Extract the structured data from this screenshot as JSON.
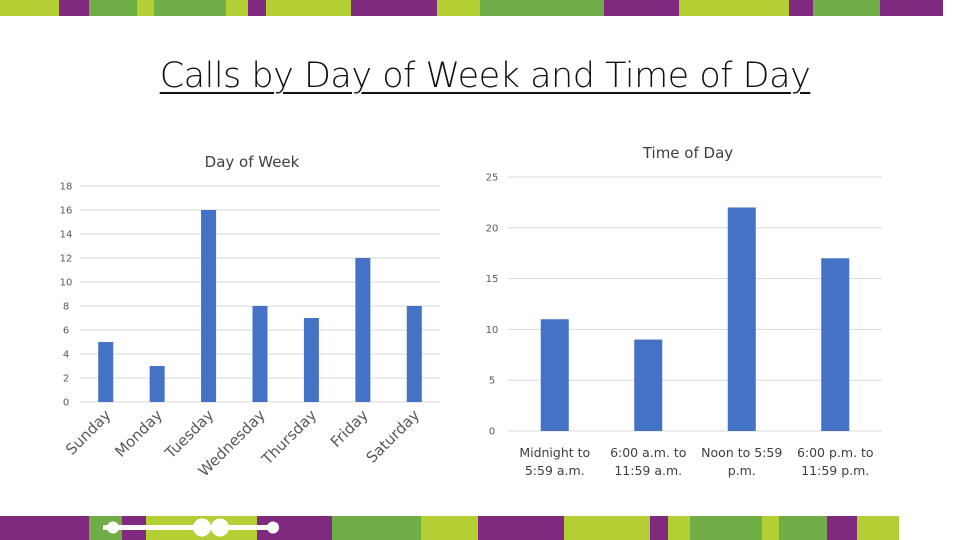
{
  "page": {
    "title": "Calls by Day of Week and Time of Day"
  },
  "decor": {
    "colors": {
      "lime": "#b3cf33",
      "green": "#70ad47",
      "purple": "#7f2a7f",
      "bar": "#4472c4",
      "grid": "#d9d9d9"
    },
    "top_band": [
      "lime",
      "purple",
      "green",
      "lime",
      "green",
      "lime",
      "purple",
      "lime",
      "purple",
      "lime",
      "green",
      "purple",
      "lime",
      "purple",
      "green",
      "purple"
    ],
    "bottom_band": [
      "purple",
      "green",
      "purple",
      "lime",
      "purple",
      "green",
      "green",
      "lime",
      "purple",
      "lime",
      "purple",
      "lime",
      "green",
      "lime",
      "green",
      "purple",
      "lime"
    ],
    "logo_icon": "utensils-dots-icon"
  },
  "chart_data": [
    {
      "type": "bar",
      "title": "Day of Week",
      "categories": [
        "Sunday",
        "Monday",
        "Tuesday",
        "Wednesday",
        "Thursday",
        "Friday",
        "Saturday"
      ],
      "values": [
        5,
        3,
        16,
        8,
        7,
        12,
        8
      ],
      "ylim": [
        0,
        18
      ],
      "yticks": [
        "0",
        "2",
        "4",
        "6",
        "8",
        "10",
        "12",
        "14",
        "16",
        "18"
      ],
      "xlabel": "",
      "ylabel": "",
      "grid": true,
      "legend": "none",
      "xtick_rotation": "-45"
    },
    {
      "type": "bar",
      "title": "Time of Day",
      "categories": [
        "Midnight to 5:59 a.m.",
        "6:00 a.m. to 11:59 a.m.",
        "Noon to 5:59 p.m.",
        "6:00 p.m. to 11:59 p.m."
      ],
      "category_lines": [
        [
          "Midnight to",
          "5:59 a.m."
        ],
        [
          "6:00 a.m. to",
          "11:59 a.m."
        ],
        [
          "Noon to 5:59",
          "p.m."
        ],
        [
          "6:00 p.m. to",
          "11:59 p.m."
        ]
      ],
      "values": [
        11,
        9,
        22,
        17
      ],
      "ylim": [
        0,
        25
      ],
      "yticks": [
        "0",
        "5",
        "10",
        "15",
        "20",
        "25"
      ],
      "xlabel": "",
      "ylabel": "",
      "grid": true,
      "legend": "none"
    }
  ]
}
